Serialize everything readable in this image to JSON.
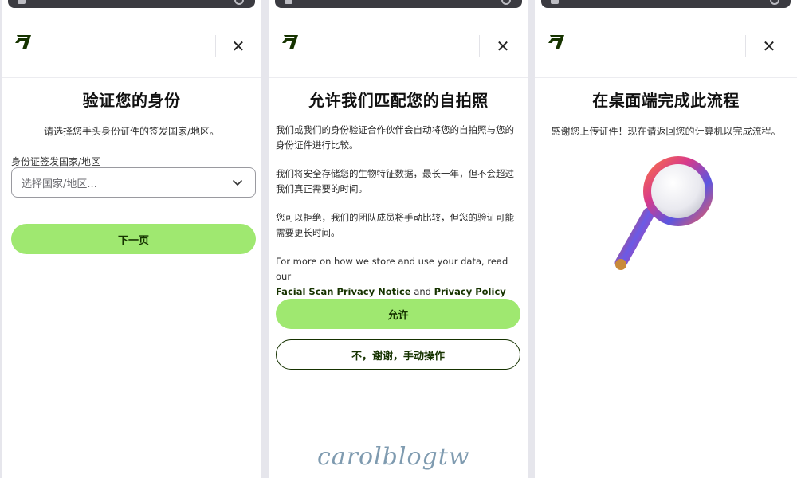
{
  "panels": [
    {
      "title": "验证您的身份",
      "subtitle": "请选择您手头身份证件的签发国家/地区。",
      "field_label": "身份证签发国家/地区",
      "select_placeholder": "选择国家/地区...",
      "next_button": "下一页"
    },
    {
      "title": "允许我们匹配您的自拍照",
      "paragraph1": "我们或我们的身份验证合作伙伴会自动将您的自拍照与您的身份证件进行比较。",
      "paragraph2": "我们将安全存储您的生物特征数据，最长一年，但不会超过我们真正需要的时间。",
      "paragraph3": "您可以拒绝，我们的团队成员将手动比较，但您的验证可能需要更长时间。",
      "privacy_text_prefix": "For more on how we store and use your data, read our",
      "facial_scan_link": "Facial Scan Privacy Notice",
      "and_text": "and",
      "privacy_policy_link": "Privacy Policy",
      "allow_button": "允许",
      "manual_button": "不，谢谢，手动操作"
    },
    {
      "title": "在桌面端完成此流程",
      "subtitle": "感谢您上传证件！现在请返回您的计算机以完成流程。"
    }
  ],
  "close_glyph": "✕",
  "watermark": "carolblogtw",
  "colors": {
    "brand_green": "#9fe870",
    "forest_green": "#163300"
  },
  "icons": [
    "logo-icon",
    "close-icon",
    "chevron-down-icon",
    "magnifier-illustration"
  ]
}
